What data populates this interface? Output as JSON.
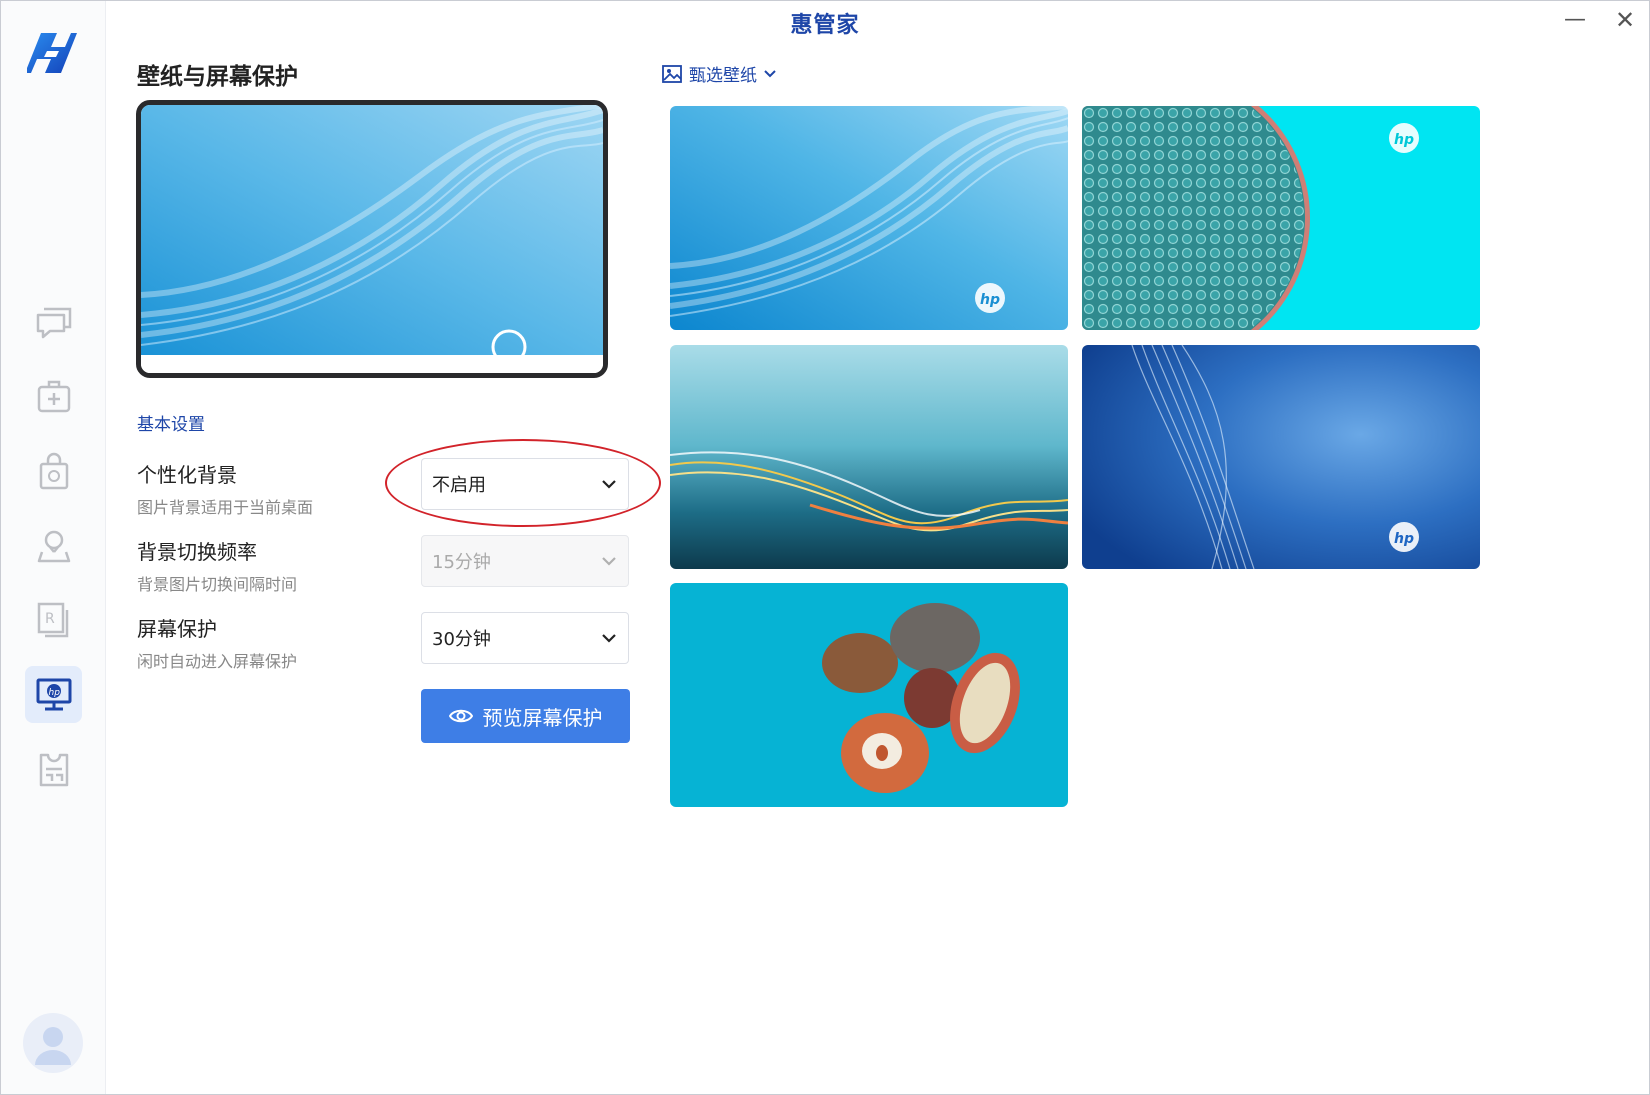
{
  "window": {
    "title": "惠管家",
    "minimize_icon": "minimize-icon",
    "close_icon": "close-icon"
  },
  "sidebar": {
    "logo": "hp-app-logo",
    "items": [
      {
        "icon": "chat-bubbles-icon",
        "active": false
      },
      {
        "icon": "medical-kit-icon",
        "active": false
      },
      {
        "icon": "shopping-bag-icon",
        "active": false
      },
      {
        "icon": "location-pin-icon",
        "active": false
      },
      {
        "icon": "registered-document-icon",
        "active": false
      },
      {
        "icon": "monitor-hp-icon",
        "active": true
      },
      {
        "icon": "receipt-icon",
        "active": false
      }
    ],
    "avatar_icon": "user-avatar-icon"
  },
  "main": {
    "page_title": "壁纸与屏幕保护",
    "filter_label": "甄选壁纸",
    "section_label": "基本设置",
    "settings": [
      {
        "title": "个性化背景",
        "desc": "图片背景适用于当前桌面",
        "value": "不启用",
        "disabled": false
      },
      {
        "title": "背景切换频率",
        "desc": "背景图片切换间隔时间",
        "value": "15分钟",
        "disabled": true
      },
      {
        "title": "屏幕保护",
        "desc": "闲时自动进入屏幕保护",
        "value": "30分钟",
        "disabled": false
      }
    ],
    "preview_button_label": "预览屏幕保护",
    "wallpapers": [
      {
        "name": "blue-wave-wallpaper"
      },
      {
        "name": "cyan-bubbles-wallpaper"
      },
      {
        "name": "light-trails-wallpaper"
      },
      {
        "name": "blue-fiber-wallpaper"
      },
      {
        "name": "pebbles-wallpaper"
      }
    ]
  },
  "colors": {
    "accent": "#1e46a8",
    "button": "#3e7ee6",
    "annotation": "#d2232a"
  }
}
